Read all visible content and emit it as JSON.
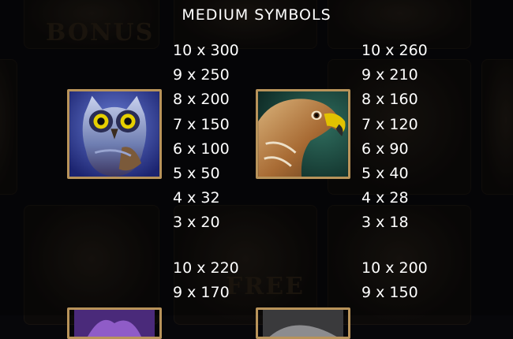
{
  "title": "MEDIUM SYMBOLS",
  "background_words": [
    "BONUS",
    "FREE"
  ],
  "symbols": [
    {
      "icon": "owl-icon",
      "payouts": [
        "10 x 300",
        "9 x 250",
        "8 x 200",
        "7 x 150",
        "6 x 100",
        "5 x 50",
        "4 x 32",
        "3 x 20"
      ]
    },
    {
      "icon": "eagle-icon",
      "payouts": [
        "10 x 260",
        "9 x 210",
        "8 x 160",
        "7 x 120",
        "6 x 90",
        "5 x 40",
        "4 x 28",
        "3 x 18"
      ]
    },
    {
      "icon": "purple-symbol-icon",
      "payouts": [
        "10 x 220",
        "9 x 170"
      ]
    },
    {
      "icon": "grey-symbol-icon",
      "payouts": [
        "10 x 200",
        "9 x 150"
      ]
    }
  ],
  "colors": {
    "frame": "#b8935a",
    "text": "#ffffff",
    "background": "#07070a"
  }
}
